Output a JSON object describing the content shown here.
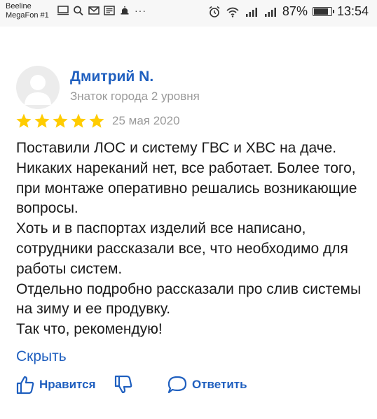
{
  "status_bar": {
    "carrier_line1": "Beeline",
    "carrier_line2": "MegaFon #1",
    "battery_text": "87%",
    "battery_level": 0.87,
    "time": "13:54",
    "icons": [
      "screen-icon",
      "search-icon",
      "mail-icon",
      "news-icon",
      "notification-icon",
      "more-icon",
      "alarm-icon",
      "wifi-icon",
      "signal-icon",
      "signal-icon",
      "battery-icon"
    ]
  },
  "review": {
    "author": "Дмитрий N.",
    "level": "Знаток города 2 уровня",
    "rating": 5,
    "rating_max": 5,
    "date": "25 мая 2020",
    "paragraphs": [
      "Поставили ЛОС и систему ГВС и ХВС на даче. Никаких нареканий нет, все работает. Более того, при монтаже оперативно решались возникающие вопросы.",
      "Хоть и в паспортах изделий все написано, сотрудники рассказали все, что необходимо для работы систем.",
      "Отдельно подробно рассказали про слив системы на зиму и ее продувку.",
      "Так что, рекомендую!"
    ],
    "hide_label": "Скрыть"
  },
  "actions": {
    "like_label": "Нравится",
    "reply_label": "Ответить"
  },
  "colors": {
    "accent": "#1f5fbf",
    "star": "#ffcc00",
    "muted": "#9a9a9a"
  }
}
